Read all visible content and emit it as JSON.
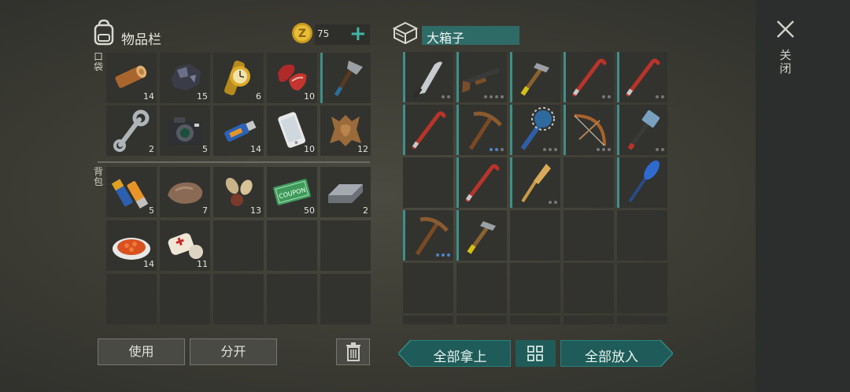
{
  "inventory": {
    "title": "物品栏",
    "coins": "75",
    "pocket_label": "口袋",
    "backpack_label": "背包",
    "pocket": [
      {
        "icon": "log-icon",
        "count": "14"
      },
      {
        "icon": "coal-ore-icon",
        "count": "15"
      },
      {
        "icon": "gold-watch-icon",
        "count": "6"
      },
      {
        "icon": "raw-meat-icon",
        "count": "10"
      },
      {
        "icon": "hatchet-icon",
        "count": ""
      },
      {
        "icon": "wrench-icon",
        "count": "2"
      },
      {
        "icon": "camera-icon",
        "count": "5"
      },
      {
        "icon": "usb-drive-icon",
        "count": "14"
      },
      {
        "icon": "smartphone-icon",
        "count": "10"
      },
      {
        "icon": "animal-hide-icon",
        "count": "12"
      }
    ],
    "backpack": [
      {
        "icon": "batteries-icon",
        "count": "5"
      },
      {
        "icon": "stone-icon",
        "count": "7"
      },
      {
        "icon": "seeds-icon",
        "count": "13"
      },
      {
        "icon": "ration-coupon-icon",
        "count": "50"
      },
      {
        "icon": "iron-ingot-icon",
        "count": "2"
      },
      {
        "icon": "food-plate-icon",
        "count": "14"
      },
      {
        "icon": "bandage-icon",
        "count": "11"
      },
      {
        "icon": "",
        "count": ""
      },
      {
        "icon": "",
        "count": ""
      },
      {
        "icon": "",
        "count": ""
      },
      {
        "icon": "",
        "count": ""
      },
      {
        "icon": "",
        "count": ""
      },
      {
        "icon": "",
        "count": ""
      },
      {
        "icon": "",
        "count": ""
      },
      {
        "icon": "",
        "count": ""
      }
    ],
    "use_label": "使用",
    "split_label": "分开"
  },
  "chest": {
    "title": "大箱子",
    "slots": [
      {
        "icon": "machete-icon"
      },
      {
        "icon": "shotgun-icon"
      },
      {
        "icon": "hammer-icon"
      },
      {
        "icon": "crowbar-icon"
      },
      {
        "icon": "crowbar-icon"
      },
      {
        "icon": "crowbar-icon"
      },
      {
        "icon": "pickaxe-icon"
      },
      {
        "icon": "spiked-club-icon"
      },
      {
        "icon": "bow-icon"
      },
      {
        "icon": "sledgehammer-icon"
      },
      {
        "icon": ""
      },
      {
        "icon": "crowbar-icon"
      },
      {
        "icon": "wooden-oar-icon"
      },
      {
        "icon": ""
      },
      {
        "icon": "paddle-icon"
      },
      {
        "icon": "pickaxe-icon"
      },
      {
        "icon": "hammer-icon"
      },
      {
        "icon": ""
      },
      {
        "icon": ""
      },
      {
        "icon": ""
      },
      {
        "icon": ""
      },
      {
        "icon": ""
      },
      {
        "icon": ""
      },
      {
        "icon": ""
      },
      {
        "icon": ""
      },
      {
        "icon": ""
      },
      {
        "icon": ""
      },
      {
        "icon": ""
      },
      {
        "icon": ""
      },
      {
        "icon": ""
      }
    ],
    "take_all_label": "全部拿上",
    "put_all_label": "全部放入"
  },
  "close_label": "关闭",
  "colors": {
    "accent": "#1f5c59",
    "teal_bar": "#3e8f8a",
    "slot": "#32332e"
  }
}
